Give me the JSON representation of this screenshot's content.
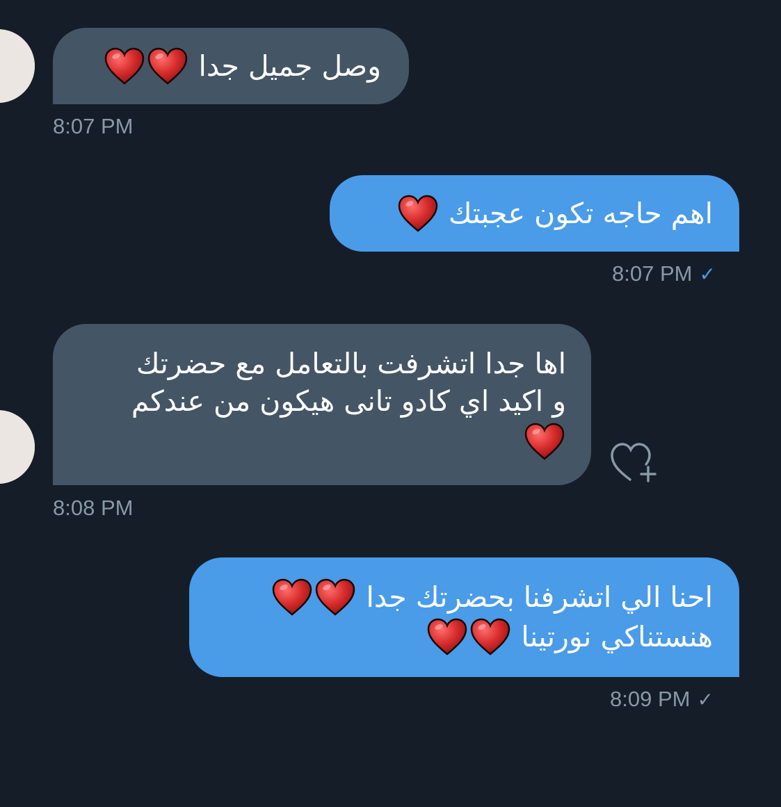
{
  "conversation": {
    "messages": [
      {
        "id": "m1",
        "direction": "incoming",
        "text_lines": [
          "وصل جميل جدا"
        ],
        "emoji": [
          "red-heart",
          "red-heart"
        ],
        "time": "8:07 PM"
      },
      {
        "id": "m2",
        "direction": "outgoing",
        "text_lines": [
          "اهم حاجه تكون عجبتك"
        ],
        "emoji": [
          "red-heart"
        ],
        "time": "8:07 PM",
        "status": "read"
      },
      {
        "id": "m3",
        "direction": "incoming",
        "text_lines": [
          "اها جدا اتشرفت بالتعامل مع حضرتك",
          "و اكيد اي كادو تانى هيكون من عندكم"
        ],
        "emoji": [
          "red-heart"
        ],
        "time": "8:08 PM",
        "reaction_button": "add-reaction-heart-icon"
      },
      {
        "id": "m4",
        "direction": "outgoing",
        "text_lines": [
          "احنا الي اتشرفنا بحضرتك جدا",
          "هنستناكي نورتينا"
        ],
        "emoji": [
          "red-heart",
          "red-heart",
          "red-heart",
          "red-heart"
        ],
        "time": "8:09 PM",
        "status": "sent"
      }
    ],
    "check_glyph": "✓"
  },
  "colors": {
    "background": "#151d28",
    "incoming_bubble": "#445566",
    "outgoing_bubble": "#4a9be8",
    "timestamp": "#8899a6",
    "read_check": "#4a9be8",
    "heart": "#d62b2b"
  }
}
